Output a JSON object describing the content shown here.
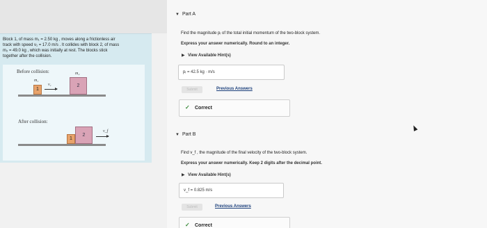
{
  "problem": {
    "line1": "Block 1, of mass m₁ = 2.50 kg , moves along a frictionless air",
    "line2": "track with speed v₁ = 17.0 m/s . It collides with block 2, of mass",
    "line3": "m₂ = 49.0 kg , which was initially at rest. The blocks stick",
    "line4": "together after the collision.",
    "before_label": "Before collision:",
    "after_label": "After collision:",
    "m1_label": "m₁",
    "m2_label": "m₂",
    "v1_label": "v₁",
    "vf_label": "v_f",
    "block1_num": "1",
    "block2_num": "2"
  },
  "partA": {
    "title": "Part A",
    "question": "Find the magnitude pᵢ of the total initial momentum of the two-block system.",
    "instruction": "Express your answer numerically. Round to an integer.",
    "hint": "View Available Hint(s)",
    "answer": "pᵢ =  42.5  kg · m/s",
    "submit": "Submit",
    "previous": "Previous Answers",
    "correct": "Correct"
  },
  "partB": {
    "title": "Part B",
    "question": "Find v_f , the magnitude of the final velocity of the two-block system.",
    "instruction": "Express your answer numerically. Keep 2 digits after the decimal point.",
    "hint": "View Available Hint(s)",
    "answer": "v_f =  0.825  m/s",
    "submit": "Submit",
    "previous": "Previous Answers",
    "correct": "Correct"
  },
  "colors": {
    "panel": "#d6eaf0",
    "block1": "#e8a36b",
    "block2": "#d9a3b6",
    "check": "#3a8a3a",
    "link": "#1a3e7a"
  },
  "icons": [
    "caret-down-icon",
    "caret-right-icon",
    "check-icon",
    "mouse-cursor-icon"
  ]
}
